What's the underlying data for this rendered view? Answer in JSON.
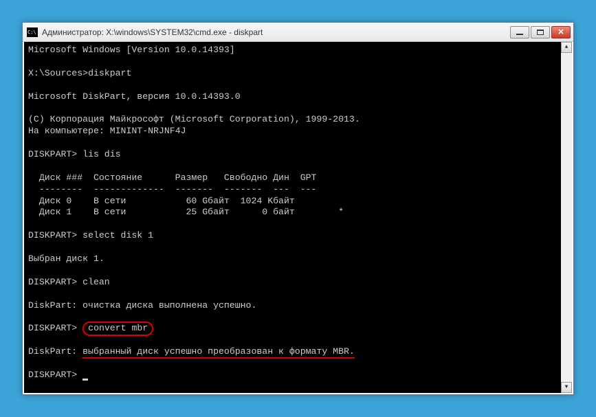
{
  "window": {
    "title": "Администратор: X:\\windows\\SYSTEM32\\cmd.exe - diskpart"
  },
  "terminal": {
    "line1": "Microsoft Windows [Version 10.0.14393]",
    "prompt1": "X:\\Sources>",
    "cmd1": "diskpart",
    "line3": "Microsoft DiskPart, версия 10.0.14393.0",
    "line4": "(C) Корпорация Майкрософт (Microsoft Corporation), 1999-2013.",
    "line5": "На компьютере: MININT-NRJNF4J",
    "prompt2": "DISKPART>",
    "cmd2": "lis dis",
    "table_header": "  Диск ###  Состояние      Размер   Свободно Дин  GPT",
    "table_sep": "  --------  -------------  -------  -------  ---  ---",
    "table_row1": "  Диск 0    В сети           60 Gбайт  1024 Kбайт",
    "table_row2": "  Диск 1    В сети           25 Gбайт      0 байт        *",
    "prompt3": "DISKPART>",
    "cmd3": "select disk 1",
    "line_sel": "Выбран диск 1.",
    "prompt4": "DISKPART>",
    "cmd4": "clean",
    "line_clean": "DiskPart: очистка диска выполнена успешно.",
    "prompt5": "DISKPART>",
    "cmd5": "convert mbr",
    "line_conv_prefix": "DiskPart: ",
    "line_conv_text": "выбранный диск успешно преобразован к формату MBR.",
    "prompt6": "DISKPART>"
  }
}
